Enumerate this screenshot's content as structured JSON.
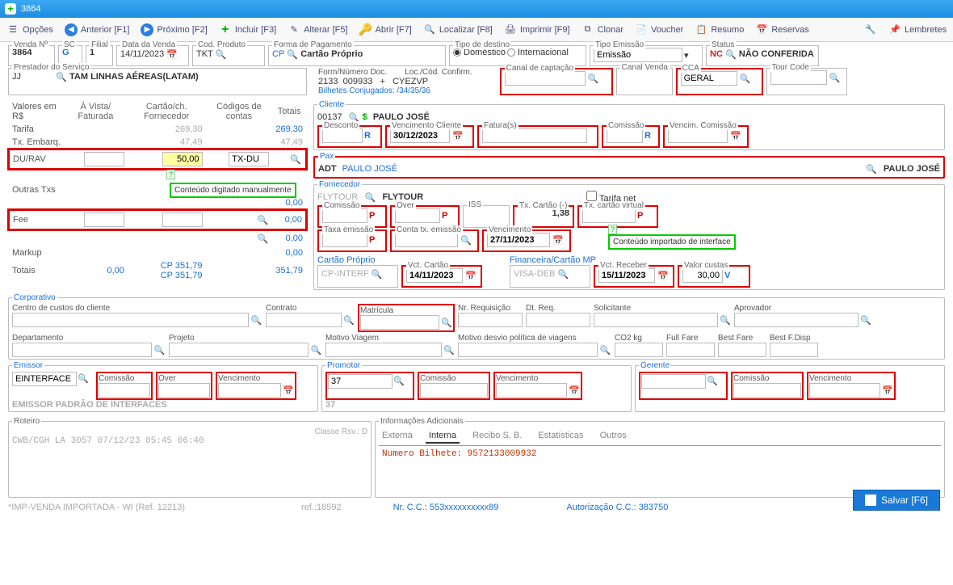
{
  "window": {
    "title": "3864"
  },
  "toolbar": {
    "opcoes": "Opções",
    "anterior": "Anterior [F1]",
    "proximo": "Próximo [F2]",
    "incluir": "Incluir [F3]",
    "alterar": "Alterar [F5]",
    "abrir": "Abrir [F7]",
    "localizar": "Localizar [F8]",
    "imprimir": "Imprimir [F9]",
    "clonar": "Clonar",
    "voucher": "Voucher",
    "resumo": "Resumo",
    "reservas": "Reservas",
    "lembretes": "Lembretes"
  },
  "header": {
    "venda_no_label": "Venda Nº",
    "venda_no": "3864",
    "sc_label": "SC",
    "sc": "G",
    "filial_label": "Filial",
    "filial": "1",
    "data_venda_label": "Data da Venda",
    "data_venda": "14/11/2023",
    "cod_produto_label": "Cod. Produto",
    "cod_produto": "TKT",
    "forma_pagamento_label": "Forma de Pagamento",
    "forma_pagamento_code": "CP",
    "forma_pagamento": "Cartão Próprio",
    "tipo_destino_label": "Tipo de destino",
    "tipo_destino_dom": "Doméstico",
    "tipo_destino_int": "Internacional",
    "tipo_emissao_label": "Tipo Emissão",
    "tipo_emissao": "Emissão",
    "status_label": "Status",
    "status_code": "NC",
    "status": "NÃO CONFERIDA",
    "prestador_label": "Prestador do Serviço",
    "prestador_code": "JJ",
    "prestador": "TAM LINHAS AÉREAS(LATAM)",
    "form_doc_label": "Form/Número Doc.",
    "form_doc_a": "2133",
    "form_doc_b": "009933",
    "form_doc_plus": "+",
    "loc_label": "Loc./Cód. Confirm.",
    "loc": "CYEZVP",
    "bilhetes_conj": "Bilhetes Conjugados: /34/35/36",
    "canal_capt_label": "Canal de captação",
    "canal_venda_label": "Canal Venda",
    "cca_label": "CCA",
    "cca": "GERAL",
    "tour_code_label": "Tour Code"
  },
  "valores": {
    "hdr_valores": "Valores em R$",
    "hdr_avista": "À Vista/ Faturada",
    "hdr_cartao": "Cartão/ch. Fornecedor",
    "hdr_codigos": "Códigos de contas",
    "hdr_totais": "Totais",
    "tarifa": "Tarifa",
    "tarifa_cart": "269,30",
    "tarifa_tot": "269,30",
    "tx_embarq": "Tx. Embarq.",
    "tx_embarq_cart": "47,49",
    "tx_embarq_tot": "47,49",
    "durav": "DU/RAV",
    "durav_cart": "50,00",
    "durav_code": "TX-DU",
    "outras": "Outras Txs",
    "outras_tot": "0,00",
    "fee": "Fee",
    "fee_tot1": "0,00",
    "fee_tot2": "0,00",
    "markup": "Markup",
    "markup_tot": "0,00",
    "totais": "Totais",
    "totais_avista": "0,00",
    "totais_cp1": "CP 351,79",
    "totais_cp2": "CP 351,79",
    "totais_fin": "351,79"
  },
  "tips": {
    "manual": "Conteúdo digitado manualmente",
    "imported": "Conteúdo importado de interface"
  },
  "cliente": {
    "legend": "Cliente",
    "code": "00137",
    "nome": "PAULO JOSÉ",
    "desconto_label": "Desconto",
    "vcto_cliente_label": "Vencimento Cliente",
    "vcto_cliente": "30/12/2023",
    "faturas_label": "Fatura(s)",
    "comissao_label": "Comissão",
    "vcto_comissao_label": "Vencim. Comissão"
  },
  "pax": {
    "legend": "Pax",
    "adt": "ADT",
    "nome": "PAULO JOSÉ",
    "nome2": "PAULO JOSÉ"
  },
  "fornecedor": {
    "legend": "Fornecedor",
    "code": "FLYTOUR",
    "nome": "FLYTOUR",
    "tarifa_net": "Tarifa net",
    "comissao_label": "Comissão",
    "over_label": "Over",
    "iss_label": "ISS",
    "tx_cartao_label": "Tx. Cartão (-)",
    "tx_cartao": "1,38",
    "tx_cartao_virtual_label": "Tx. cartão virtual",
    "taxa_emissao_label": "Taxa emissão",
    "conta_tx_emissao_label": "Conta tx. emissão",
    "vencimento_label": "Vencimento",
    "vencimento": "27/11/2023"
  },
  "cartao_proprio": {
    "label": "Cartão Próprio",
    "code": "CP-INTERF",
    "vct_label": "Vct. Cartão",
    "vct": "14/11/2023"
  },
  "financeira": {
    "label": "Financeira/Cartão MP",
    "code": "VISA-DEB",
    "vct_receber_label": "Vct. Receber",
    "vct_receber": "15/11/2023",
    "valor_custas_label": "Valor custas",
    "valor_custas": "30,00"
  },
  "corporativo": {
    "legend": "Corporativo",
    "centro_custos": "Centro de custos do cliente",
    "contrato": "Contrato",
    "matricula": "Matrícula",
    "nr_requisicao": "Nr. Requisição",
    "dt_req": "Dt. Req.",
    "solicitante": "Solicitante",
    "aprovador": "Aprovador",
    "departamento": "Departamento",
    "projeto": "Projeto",
    "motivo_viagem": "Motivo Viagem",
    "motivo_desvio": "Motivo desvio política de viagens",
    "co2": "CO2 kg",
    "full_fare": "Full Fare",
    "best_fare": "Best Fare",
    "best_fdisp": "Best F.Disp"
  },
  "emissor": {
    "legend": "Emissor",
    "code": "EINTERFACE",
    "sub": "EMISSOR PADRÃO DE INTERFACES",
    "comissao": "Comissão",
    "over": "Over",
    "vencimento": "Vencimento"
  },
  "promotor": {
    "legend": "Promotor",
    "code": "37",
    "sub": "37",
    "comissao": "Comissão",
    "vencimento": "Vencimento"
  },
  "gerente": {
    "legend": "Gerente",
    "comissao": "Comissão",
    "vencimento": "Vencimento"
  },
  "roteiro": {
    "legend": "Roteiro",
    "classe": "Classe Rsv.: D",
    "text": "CWB/CGH LA 3057 07/12/23 05:45 06:40"
  },
  "info_adic": {
    "legend": "Informações Adicionais",
    "tab_externa": "Externa",
    "tab_interna": "Interna",
    "tab_recibo": "Recibo S. B.",
    "tab_estat": "Estatísticas",
    "tab_outros": "Outros",
    "linha": "Numero Bilhete: 9572133009932"
  },
  "footer": {
    "imp": "*IMP-VENDA IMPORTADA - WI (Ref. 12213)",
    "ref": "ref.:18592",
    "nrcc_label": "Nr. C.C.:",
    "nrcc": "553xxxxxxxxxx89",
    "autcc_label": "Autorização C.C.:",
    "autcc": "383750"
  },
  "save": "Salvar [F6]"
}
